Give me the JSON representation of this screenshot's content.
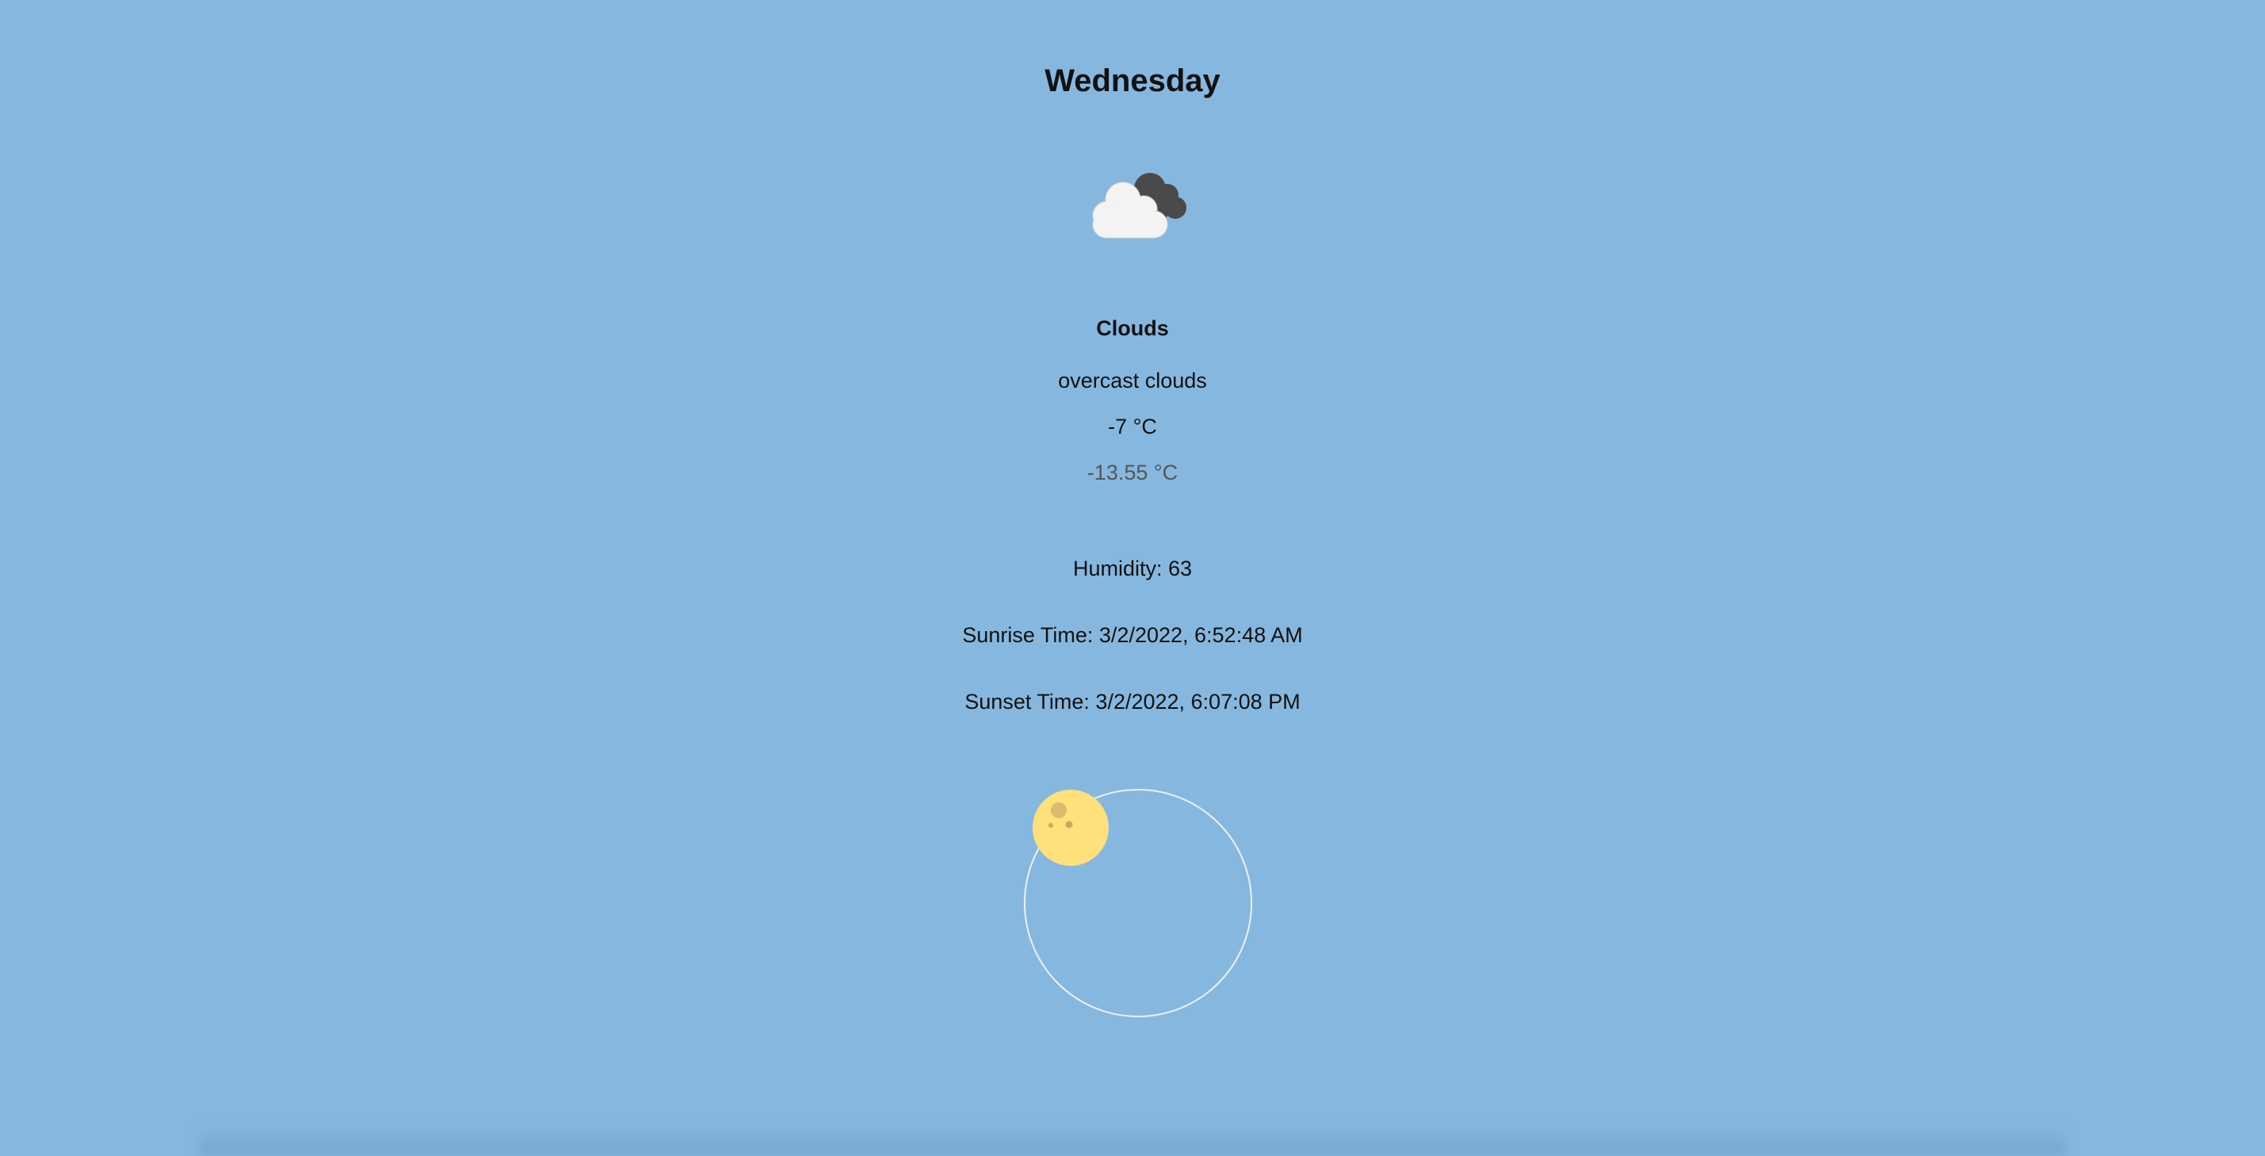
{
  "forecast": {
    "day": "Wednesday",
    "icon": "overcast-clouds-icon",
    "main": "Clouds",
    "description": "overcast clouds",
    "temperature": "-7 °C",
    "feels_like": "-13.55 °C"
  },
  "details": {
    "humidity": "Humidity: 63",
    "sunrise": "Sunrise Time: 3/2/2022, 6:52:48 AM",
    "sunset": "Sunset Time: 3/2/2022, 6:07:08 PM"
  },
  "sun_orbit": {
    "icon": "sun-icon",
    "orbit_icon": "orbit-circle"
  },
  "colors": {
    "background": "#86b8df",
    "sun": "#ffe07a",
    "orbit_line": "#e8f0f7",
    "feels_like_text": "#555555"
  }
}
